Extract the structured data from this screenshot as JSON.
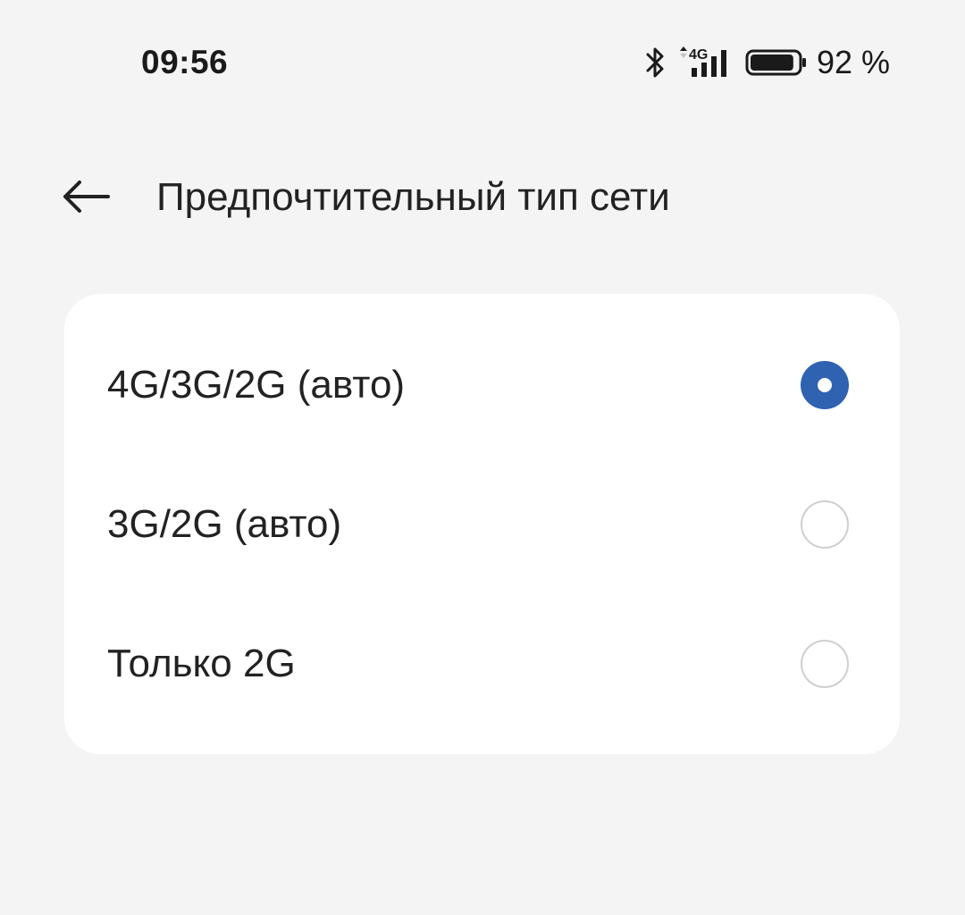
{
  "status_bar": {
    "time": "09:56",
    "network_label": "4G",
    "battery_percent": "92 %",
    "battery_level": 0.92,
    "icons": [
      "bluetooth-icon",
      "network-4g-signal-icon",
      "battery-icon"
    ]
  },
  "header": {
    "back_icon": "arrow-left-icon",
    "title": "Предпочтительный тип сети"
  },
  "options": [
    {
      "label": "4G/3G/2G (авто)",
      "selected": true
    },
    {
      "label": "3G/2G (авто)",
      "selected": false
    },
    {
      "label": "Только 2G",
      "selected": false
    }
  ],
  "colors": {
    "background": "#f4f4f4",
    "card": "#ffffff",
    "accent": "#2f62b0",
    "radio_unselected": "#cfcfcf"
  }
}
